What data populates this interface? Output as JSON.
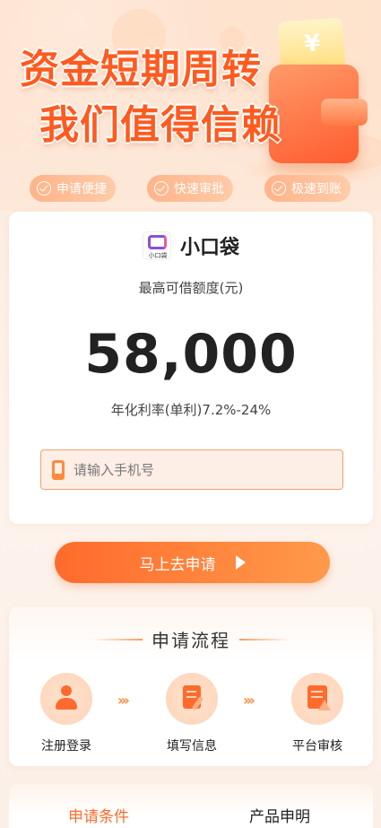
{
  "hero": {
    "title_line1": "资金短期周转",
    "title_line2": "我们值得信赖",
    "wallet_symbol": "¥",
    "features": [
      "申请便捷",
      "快速审批",
      "极速到账"
    ]
  },
  "card": {
    "logo_text": "小口袋",
    "brand_name": "小口袋",
    "limit_label": "最高可借额度(元)",
    "amount": "58,000",
    "rate": "年化利率(单利)7.2%-24%",
    "phone_placeholder": "请输入手机号"
  },
  "apply_button": "马上去申请",
  "process": {
    "title": "申请流程",
    "steps": [
      {
        "label": "注册登录",
        "icon": "user-icon"
      },
      {
        "label": "填写信息",
        "icon": "edit-document-icon"
      },
      {
        "label": "平台审核",
        "icon": "audit-document-icon"
      }
    ],
    "arrow": "›››"
  },
  "tabs": {
    "items": [
      "申请条件",
      "产品申明"
    ],
    "active_index": 0
  },
  "colors": {
    "accent": "#ff6b2c",
    "accent_light": "#ff9a4a",
    "background": "#fdf1e8"
  }
}
